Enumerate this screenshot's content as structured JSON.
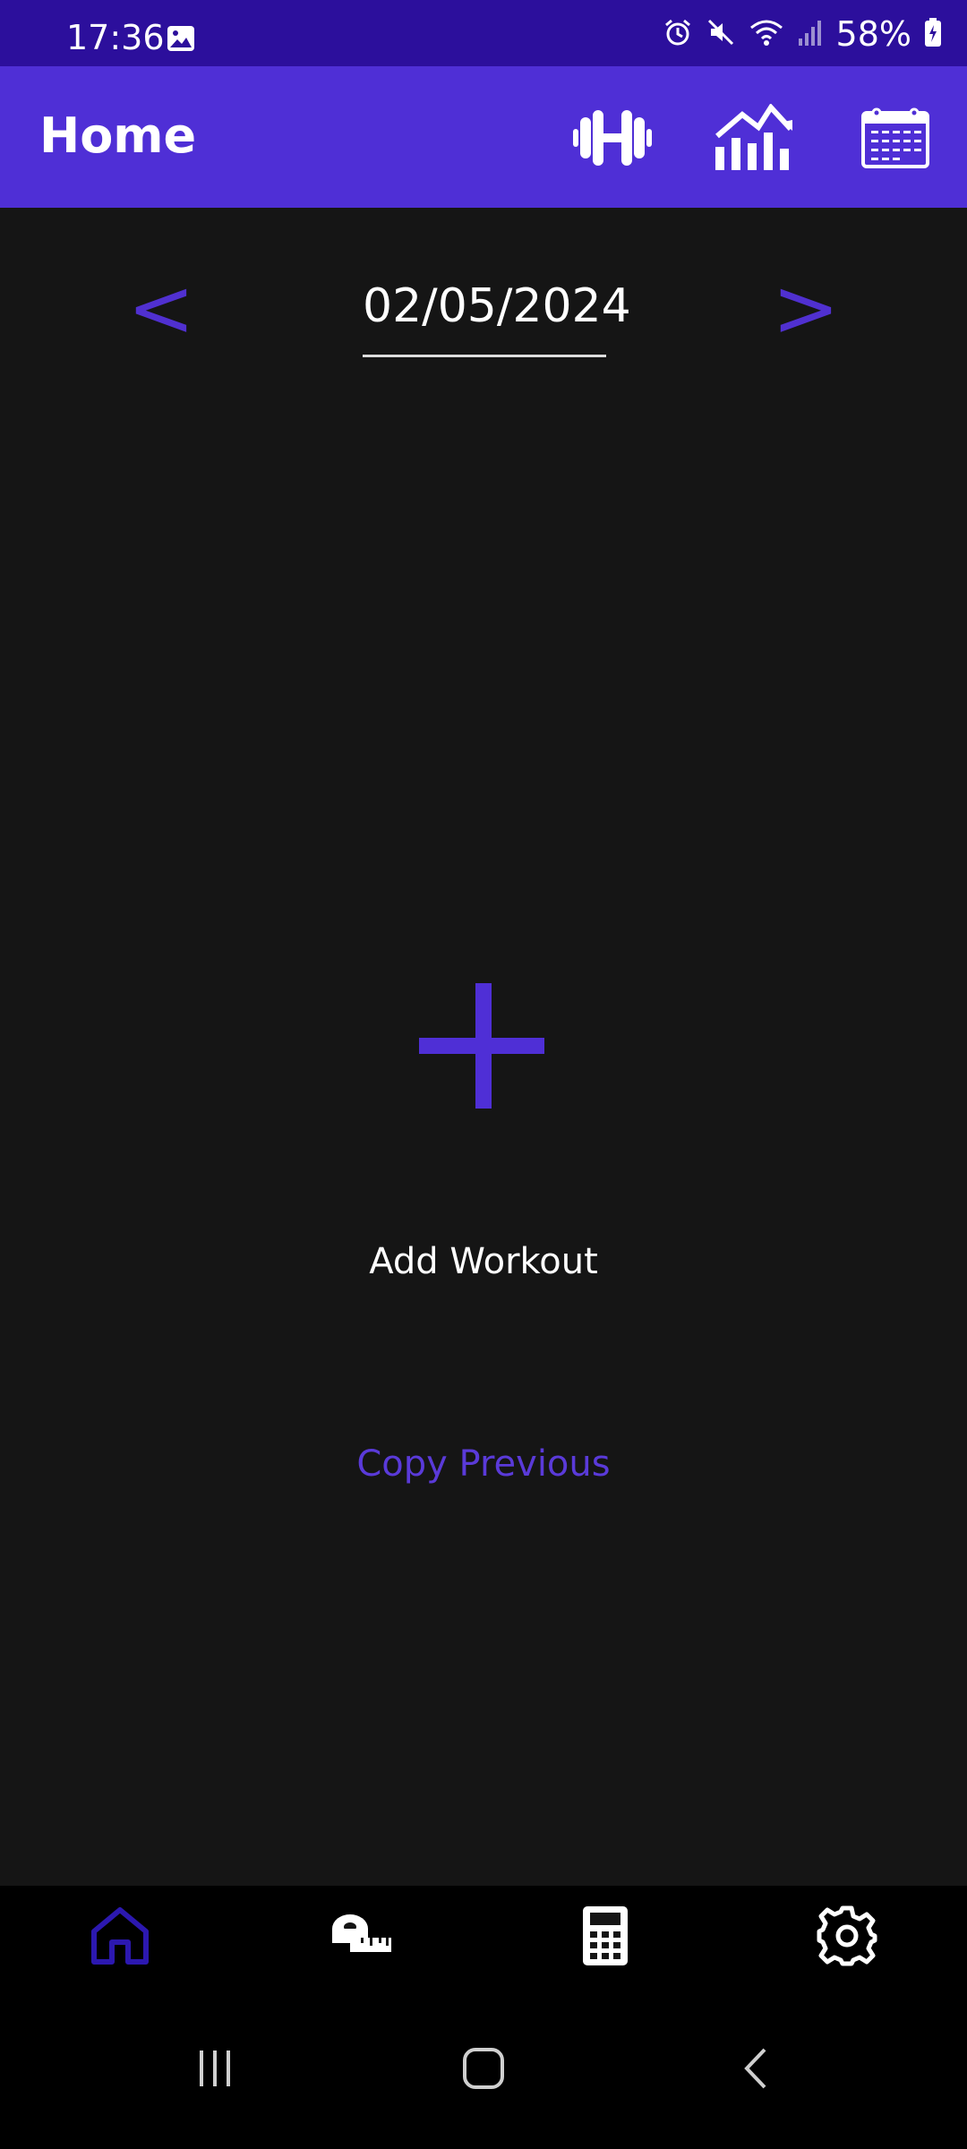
{
  "status_bar": {
    "time": "17:36",
    "battery": "58%",
    "icons": [
      "gallery-icon",
      "alarm-icon",
      "mute-icon",
      "wifi-icon",
      "signal-icon",
      "battery-charging-icon"
    ]
  },
  "app_bar": {
    "title": "Home",
    "actions": [
      "dumbbell-icon",
      "stats-chart-icon",
      "calendar-icon"
    ],
    "colors": {
      "status_bar_bg": "#2c0f9c",
      "app_bar_bg": "#4f2fd6"
    }
  },
  "date_nav": {
    "prev_label": "<",
    "date_value": "02/05/2024",
    "next_label": ">",
    "accent": "#5030d0"
  },
  "main": {
    "add_workout_label": "Add Workout",
    "copy_previous_label": "Copy Previous"
  },
  "bottom_nav": {
    "items": [
      "home-icon",
      "tape-measure-icon",
      "calculator-icon",
      "settings-icon"
    ],
    "active": "home-icon"
  },
  "system_nav": {
    "buttons": [
      "recent-apps-icon",
      "home-button-icon",
      "back-icon"
    ]
  }
}
